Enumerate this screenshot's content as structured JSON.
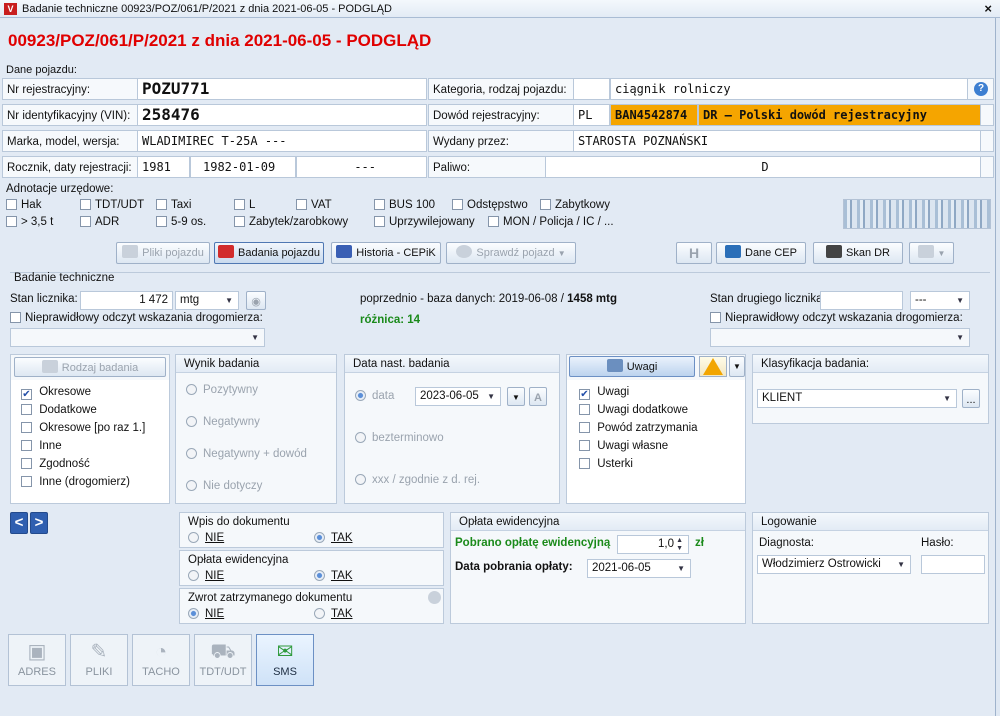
{
  "window": {
    "title": "Badanie techniczne 00923/POZ/061/P/2021 z dnia 2021-06-05 - PODGLĄD",
    "close": "×"
  },
  "heading": "00923/POZ/061/P/2021 z dnia 2021-06-05 - PODGLĄD",
  "vehicle": {
    "section": "Dane pojazdu:",
    "reg_label": "Nr rejestracyjny:",
    "reg_value": "POZU771",
    "vin_label": "Nr identyfikacyjny (VIN):",
    "vin_value": "258476",
    "make_label": "Marka, model, wersja:",
    "make_value": "WLADIMIREC T-25A ---",
    "year_label": "Rocznik, daty rejestracji:",
    "year_value": "1981",
    "reg_date_1": "1982-01-09",
    "reg_date_2": "---",
    "cat_label": "Kategoria, rodzaj pojazdu:",
    "cat_value": "ciągnik rolniczy",
    "doc_label": "Dowód rejestracyjny:",
    "doc_country": "PL",
    "doc_number": "BAN4542874",
    "doc_type": "DR – Polski dowód rejestracyjny",
    "issued_label": "Wydany przez:",
    "issued_value": "STAROSTA POZNAŃSKI",
    "fuel_label": "Paliwo:",
    "fuel_value": "D"
  },
  "annotations": {
    "label": "Adnotacje urzędowe:",
    "items": [
      "Hak",
      "TDT/UDT",
      "Taxi",
      "L",
      "VAT",
      "BUS 100",
      "Odstępstwo",
      "Zabytkowy",
      "> 3,5 t",
      "ADR",
      "5-9 os.",
      "Zabytek/zarobkowy",
      "Uprzywilejowany",
      "MON / Policja / IC / ..."
    ]
  },
  "toolbar": {
    "pliki": "Pliki pojazdu",
    "badania": "Badania pojazdu",
    "historia": "Historia - CEPiK",
    "sprawdz": "Sprawdź pojazd",
    "h": "H",
    "dane_cep": "Dane CEP",
    "skan": "Skan DR"
  },
  "test": {
    "section": "Badanie techniczne",
    "odometer_label": "Stan licznika:",
    "odometer_value": "1 472",
    "odometer_unit": "mtg",
    "invalid_label": "Nieprawidłowy odczyt wskazania drogomierza:",
    "prev_label": "poprzednio - baza danych: 2019-06-08 /",
    "prev_value": "1458 mtg",
    "diff": "różnica: 14",
    "second_label": "Stan drugiego licznika:",
    "second_unit": "---",
    "invalid_label_2": "Nieprawidłowy odczyt wskazania drogomierza:"
  },
  "rodzaj": {
    "button": "Rodzaj badania",
    "items": [
      "Okresowe",
      "Dodatkowe",
      "Okresowe [po raz 1.]",
      "Inne",
      "Zgodność",
      "Inne (drogomierz)"
    ]
  },
  "wynik": {
    "title": "Wynik badania",
    "items": [
      "Pozytywny",
      "Negatywny",
      "Negatywny + dowód",
      "Nie dotyczy"
    ]
  },
  "data_nast": {
    "title": "Data nast. badania",
    "data_label": "data",
    "date": "2023-06-05",
    "a": "A",
    "bez": "bezterminowo",
    "xxx": "xxx / zgodnie z d. rej."
  },
  "uwagi": {
    "button": "Uwagi",
    "warn": "!",
    "items": [
      "Uwagi",
      "Uwagi dodatkowe",
      "Powód zatrzymania",
      "Uwagi własne",
      "Usterki"
    ]
  },
  "klasyfikacja": {
    "title": "Klasyfikacja badania:",
    "value": "KLIENT",
    "more": "..."
  },
  "nav": {
    "prev": "<",
    "next": ">"
  },
  "wpis": {
    "title": "Wpis do dokumentu",
    "nie": "NIE",
    "tak": "TAK"
  },
  "oplata_small": {
    "title": "Opłata ewidencyjna",
    "nie": "NIE",
    "tak": "TAK"
  },
  "zwrot": {
    "title": "Zwrot zatrzymanego dokumentu",
    "nie": "NIE",
    "tak": "TAK"
  },
  "oplata": {
    "title": "Opłata ewidencyjna",
    "pobrano_label": "Pobrano opłatę ewidencyjną",
    "amount": "1,0",
    "currency": "zł",
    "date_label": "Data pobrania opłaty:",
    "date": "2021-06-05"
  },
  "logowanie": {
    "title": "Logowanie",
    "diag_label": "Diagnosta:",
    "diag_value": "Włodzimierz Ostrowicki",
    "haslo_label": "Hasło:"
  },
  "bottom": {
    "adres": "ADRES",
    "pliki": "PLIKI",
    "tacho": "TACHO",
    "tdt": "TDT/UDT",
    "sms": "SMS"
  },
  "colors": {
    "heading": "#e00000",
    "doc_highlight": "#f5a500",
    "diff": "#1a8a1a",
    "panel_bg": "#f5f8fb"
  }
}
